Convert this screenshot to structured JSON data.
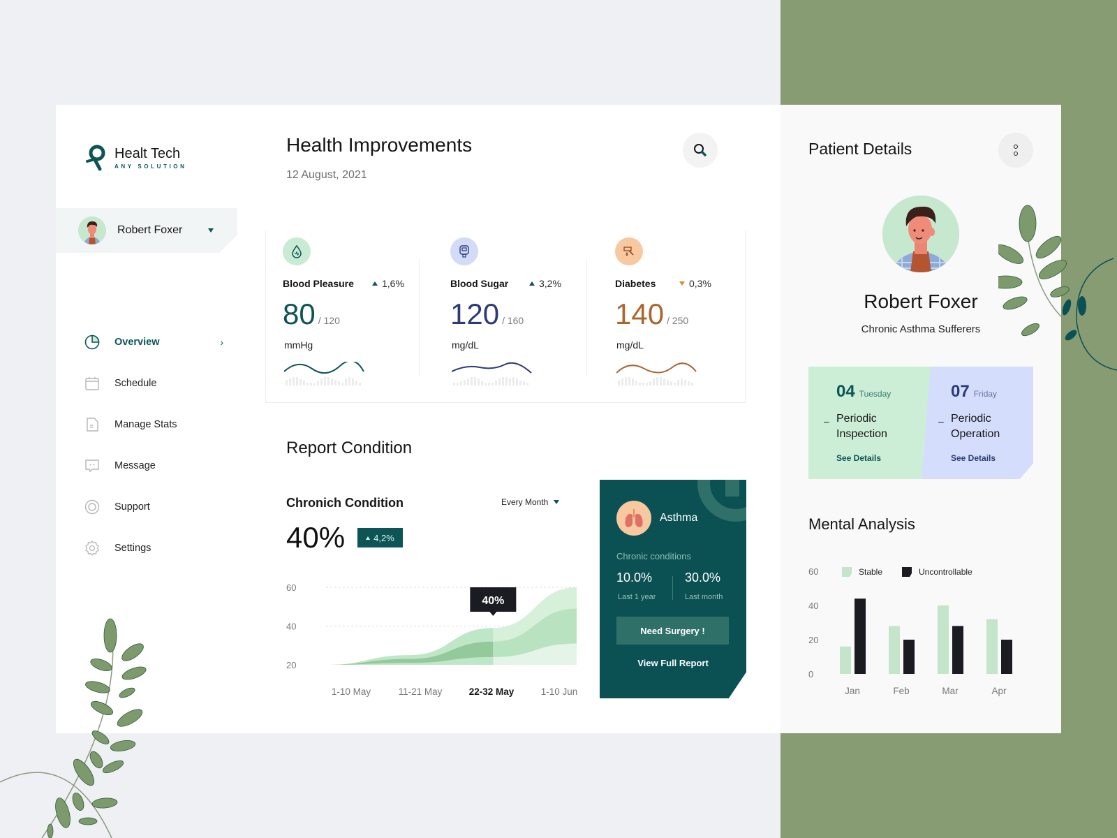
{
  "app": {
    "brand": "Healt Tech",
    "tagline": "ANY SOLUTION"
  },
  "user": {
    "name": "Robert Foxer"
  },
  "sidebar": {
    "items": [
      {
        "label": "Overview",
        "icon": "pie-chart-icon",
        "active": true
      },
      {
        "label": "Schedule",
        "icon": "calendar-icon",
        "active": false
      },
      {
        "label": "Manage Stats",
        "icon": "document-icon",
        "active": false
      },
      {
        "label": "Message",
        "icon": "chat-icon",
        "active": false
      },
      {
        "label": "Support",
        "icon": "lifebuoy-icon",
        "active": false
      },
      {
        "label": "Settings",
        "icon": "gear-icon",
        "active": false
      }
    ]
  },
  "header": {
    "title": "Health Improvements",
    "date": "12 August, 2021"
  },
  "metrics": [
    {
      "label": "Blood Pleasure",
      "change": "1,6%",
      "direction": "up",
      "value": "80",
      "max": "/ 120",
      "unit": "mmHg",
      "color": "#0d5457",
      "icon_bg": "#c9ebd3",
      "icon": "blood-drop-icon"
    },
    {
      "label": "Blood Sugar",
      "change": "3,2%",
      "direction": "up",
      "value": "120",
      "max": "/ 160",
      "unit": "mg/dL",
      "color": "#2c3a78",
      "icon_bg": "#d2dbf7",
      "icon": "glucose-meter-icon"
    },
    {
      "label": "Diabetes",
      "change": "0,3%",
      "direction": "down",
      "value": "140",
      "max": "/ 250",
      "unit": "mg/dL",
      "color": "#a8672e",
      "icon_bg": "#f8c9a0",
      "icon": "insulin-pen-icon"
    }
  ],
  "report": {
    "title": "Report Condition",
    "chronic_title": "Chronich Condition",
    "period": "Every Month",
    "value": "40%",
    "change": "4,2%",
    "tooltip": "40%"
  },
  "asthma": {
    "title": "Asthma",
    "subtitle": "Chronic conditions",
    "stat1": "10.0%",
    "stat1_label": "Last 1 year",
    "stat2": "30.0%",
    "stat2_label": "Last month",
    "surgery_button": "Need Surgery !",
    "report_link": "View Full Report"
  },
  "patient": {
    "title": "Patient Details",
    "name": "Robert Foxer",
    "condition": "Chronic Asthma Sufferers",
    "appointments": [
      {
        "day": "04",
        "weekday": "Tuesday",
        "task": "Periodic Inspection",
        "link": "See Details",
        "bg": "#cdeed6",
        "color": "#0d5457"
      },
      {
        "day": "07",
        "weekday": "Friday",
        "task": "Periodic Operation",
        "link": "See Details",
        "bg": "#d4defc",
        "color": "#2c3a78"
      }
    ]
  },
  "mental": {
    "title": "Mental Analysis"
  },
  "chart_data": [
    {
      "type": "area",
      "title": "Chronich Condition",
      "categories": [
        "1-10 May",
        "11-21 May",
        "22-32 May",
        "1-10 Jun"
      ],
      "highlighted_category": "22-32 May",
      "yticks": [
        20,
        40,
        60
      ],
      "ylim": [
        20,
        60
      ],
      "grid": true,
      "series": [
        {
          "name": "upper",
          "values": [
            20,
            25,
            39,
            60
          ]
        },
        {
          "name": "middle",
          "values": [
            20,
            23,
            32,
            49
          ]
        },
        {
          "name": "lower",
          "values": [
            20,
            21,
            24,
            31
          ]
        }
      ],
      "annotation": {
        "category": "22-32 May",
        "label": "40%"
      }
    },
    {
      "type": "bar",
      "title": "Mental Analysis",
      "categories": [
        "Jan",
        "Feb",
        "Mar",
        "Apr"
      ],
      "yticks": [
        0,
        20,
        40,
        60
      ],
      "ylim": [
        0,
        60
      ],
      "legend": "top",
      "series": [
        {
          "name": "Stable",
          "color": "#c4e5c9",
          "values": [
            16,
            28,
            40,
            32
          ]
        },
        {
          "name": "Uncontrollable",
          "color": "#1b1c22",
          "values": [
            44,
            20,
            28,
            20
          ]
        }
      ]
    }
  ]
}
